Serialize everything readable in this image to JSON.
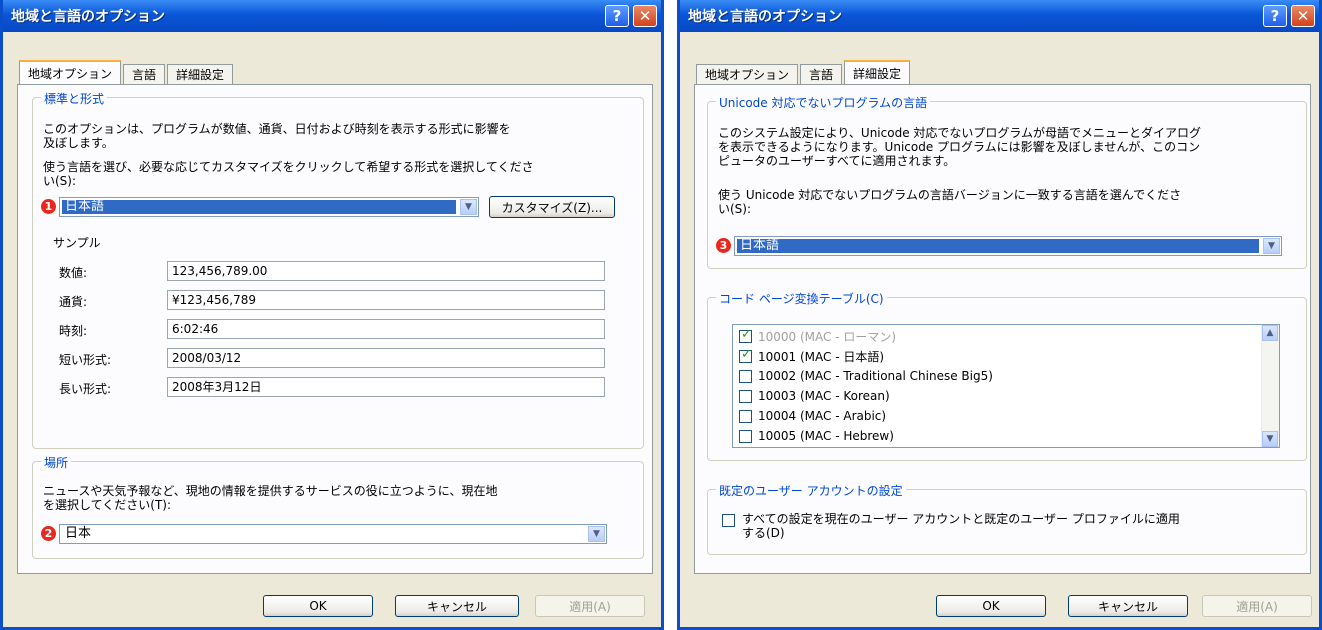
{
  "left": {
    "title": "地域と言語のオプション",
    "help_label": "?",
    "close_label": "✕",
    "tabs": [
      "地域オプション",
      "言語",
      "詳細設定"
    ],
    "standards": {
      "group_label": "標準と形式",
      "description_line1": "このオプションは、プログラムが数値、通貨、日付および時刻を表示する形式に影響を",
      "description_line2": "及ぼします。",
      "instruction_line1": "使う言語を選び、必要な応じてカスタマイズをクリックして希望する形式を選択してくださ",
      "instruction_line2": "い(S):",
      "badge": "1",
      "language": "日本語",
      "customize_label": "カスタマイズ(Z)...",
      "sample_heading": "サンプル",
      "samples": [
        {
          "label": "数値:",
          "value": "123,456,789.00"
        },
        {
          "label": "通貨:",
          "value": "¥123,456,789"
        },
        {
          "label": "時刻:",
          "value": "6:02:46"
        },
        {
          "label": "短い形式:",
          "value": "2008/03/12"
        },
        {
          "label": "長い形式:",
          "value": "2008年3月12日"
        }
      ]
    },
    "location": {
      "group_label": "場所",
      "description_line1": "ニュースや天気予報など、現地の情報を提供するサービスの役に立つように、現在地",
      "description_line2": "を選択してください(T):",
      "badge": "2",
      "value": "日本"
    },
    "buttons": {
      "ok": "OK",
      "cancel": "キャンセル",
      "apply": "適用(A)"
    }
  },
  "right": {
    "title": "地域と言語のオプション",
    "help_label": "?",
    "close_label": "✕",
    "tabs": [
      "地域オプション",
      "言語",
      "詳細設定"
    ],
    "nonunicode": {
      "group_label": "Unicode 対応でないプログラムの言語",
      "description_line1": "このシステム設定により、Unicode 対応でないプログラムが母語でメニューとダイアログ",
      "description_line2": "を表示できるようになります。Unicode プログラムには影響を及ぼしませんが、このコン",
      "description_line3": "ピュータのユーザーすべてに適用されます。",
      "instruction_line1": "使う Unicode 対応でないプログラムの言語バージョンに一致する言語を選んでくださ",
      "instruction_line2": "い(S):",
      "badge": "3",
      "language": "日本語"
    },
    "codepage": {
      "group_label": "コード ページ変換テーブル(C)",
      "items": [
        {
          "label": "10000 (MAC - ローマン)",
          "checked": true,
          "disabled": true
        },
        {
          "label": "10001 (MAC - 日本語)",
          "checked": true,
          "disabled": false
        },
        {
          "label": "10002 (MAC - Traditional Chinese Big5)",
          "checked": false,
          "disabled": false
        },
        {
          "label": "10003 (MAC - Korean)",
          "checked": false,
          "disabled": false
        },
        {
          "label": "10004 (MAC - Arabic)",
          "checked": false,
          "disabled": false
        },
        {
          "label": "10005 (MAC - Hebrew)",
          "checked": false,
          "disabled": false
        }
      ]
    },
    "default_user": {
      "group_label": "既定のユーザー アカウントの設定",
      "checkbox_line1": "すべての設定を現在のユーザー アカウントと既定のユーザー プロファイルに適用",
      "checkbox_line2": "する(D)"
    },
    "buttons": {
      "ok": "OK",
      "cancel": "キャンセル",
      "apply": "適用(A)"
    }
  }
}
